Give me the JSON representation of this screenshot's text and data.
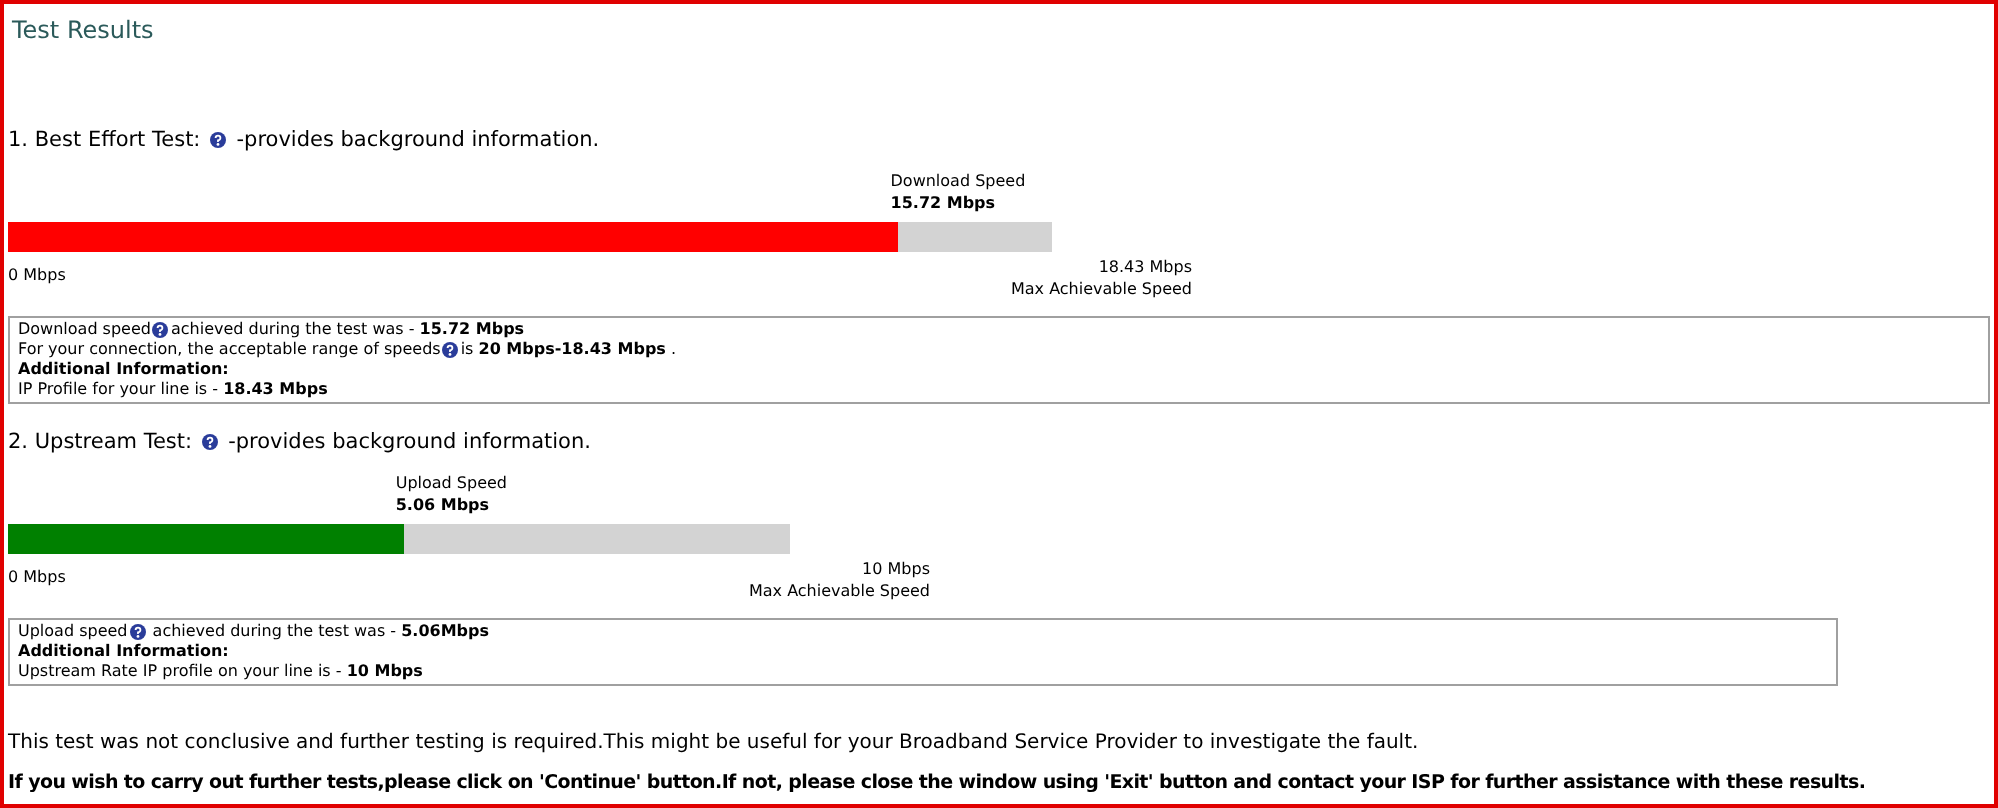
{
  "title": "Test Results",
  "tests": [
    {
      "heading_before": "1. Best Effort Test:",
      "heading_after": "-provides background information.",
      "bar_label": "Download Speed",
      "bar_value": "15.72 Mbps",
      "level": 0.853,
      "color": "#ff0000",
      "min_label": "0 Mbps",
      "max_value": "18.43 Mbps",
      "max_label": "Max Achievable Speed",
      "info": [
        [
          {
            "kind": "text",
            "text": "Download speed"
          },
          {
            "kind": "help"
          },
          {
            "kind": "text",
            "text": "achieved during the test was - **15.72 Mbps**"
          }
        ],
        [
          {
            "kind": "text",
            "text": "For your connection, the acceptable range of speeds"
          },
          {
            "kind": "help"
          },
          {
            "kind": "text",
            "text": "is **20 Mbps-18.43 Mbps** ."
          }
        ],
        [
          {
            "kind": "bold",
            "text": "Additional Information:"
          }
        ],
        [
          {
            "kind": "text",
            "text": "IP Profile for your line is - **18.43 Mbps**"
          }
        ]
      ]
    },
    {
      "heading_before": "2. Upstream Test:",
      "heading_after": "-provides background information.",
      "bar_label": "Upload Speed",
      "bar_value": "5.06 Mbps",
      "level": 0.506,
      "color": "#008000",
      "min_label": "0 Mbps",
      "max_value": "10 Mbps",
      "max_label": "Max Achievable Speed",
      "info": [
        [
          {
            "kind": "text",
            "text": "Upload speed"
          },
          {
            "kind": "help"
          },
          {
            "kind": "text",
            "text": " achieved during the test was - **5.06Mbps**"
          }
        ],
        [
          {
            "kind": "bold",
            "text": "Additional Information:"
          }
        ],
        [
          {
            "kind": "text",
            "text": "Upstream Rate IP profile on your line is - **10 Mbps**"
          }
        ]
      ]
    }
  ],
  "note": "This test was not conclusive and further testing is required.This might be useful for your Broadband Service Provider to investigate the fault.",
  "instruction": "If you wish to carry out further tests,please click on 'Continue' button.If not, please close the window using 'Exit' button and contact your ISP for further assistance with these results."
}
